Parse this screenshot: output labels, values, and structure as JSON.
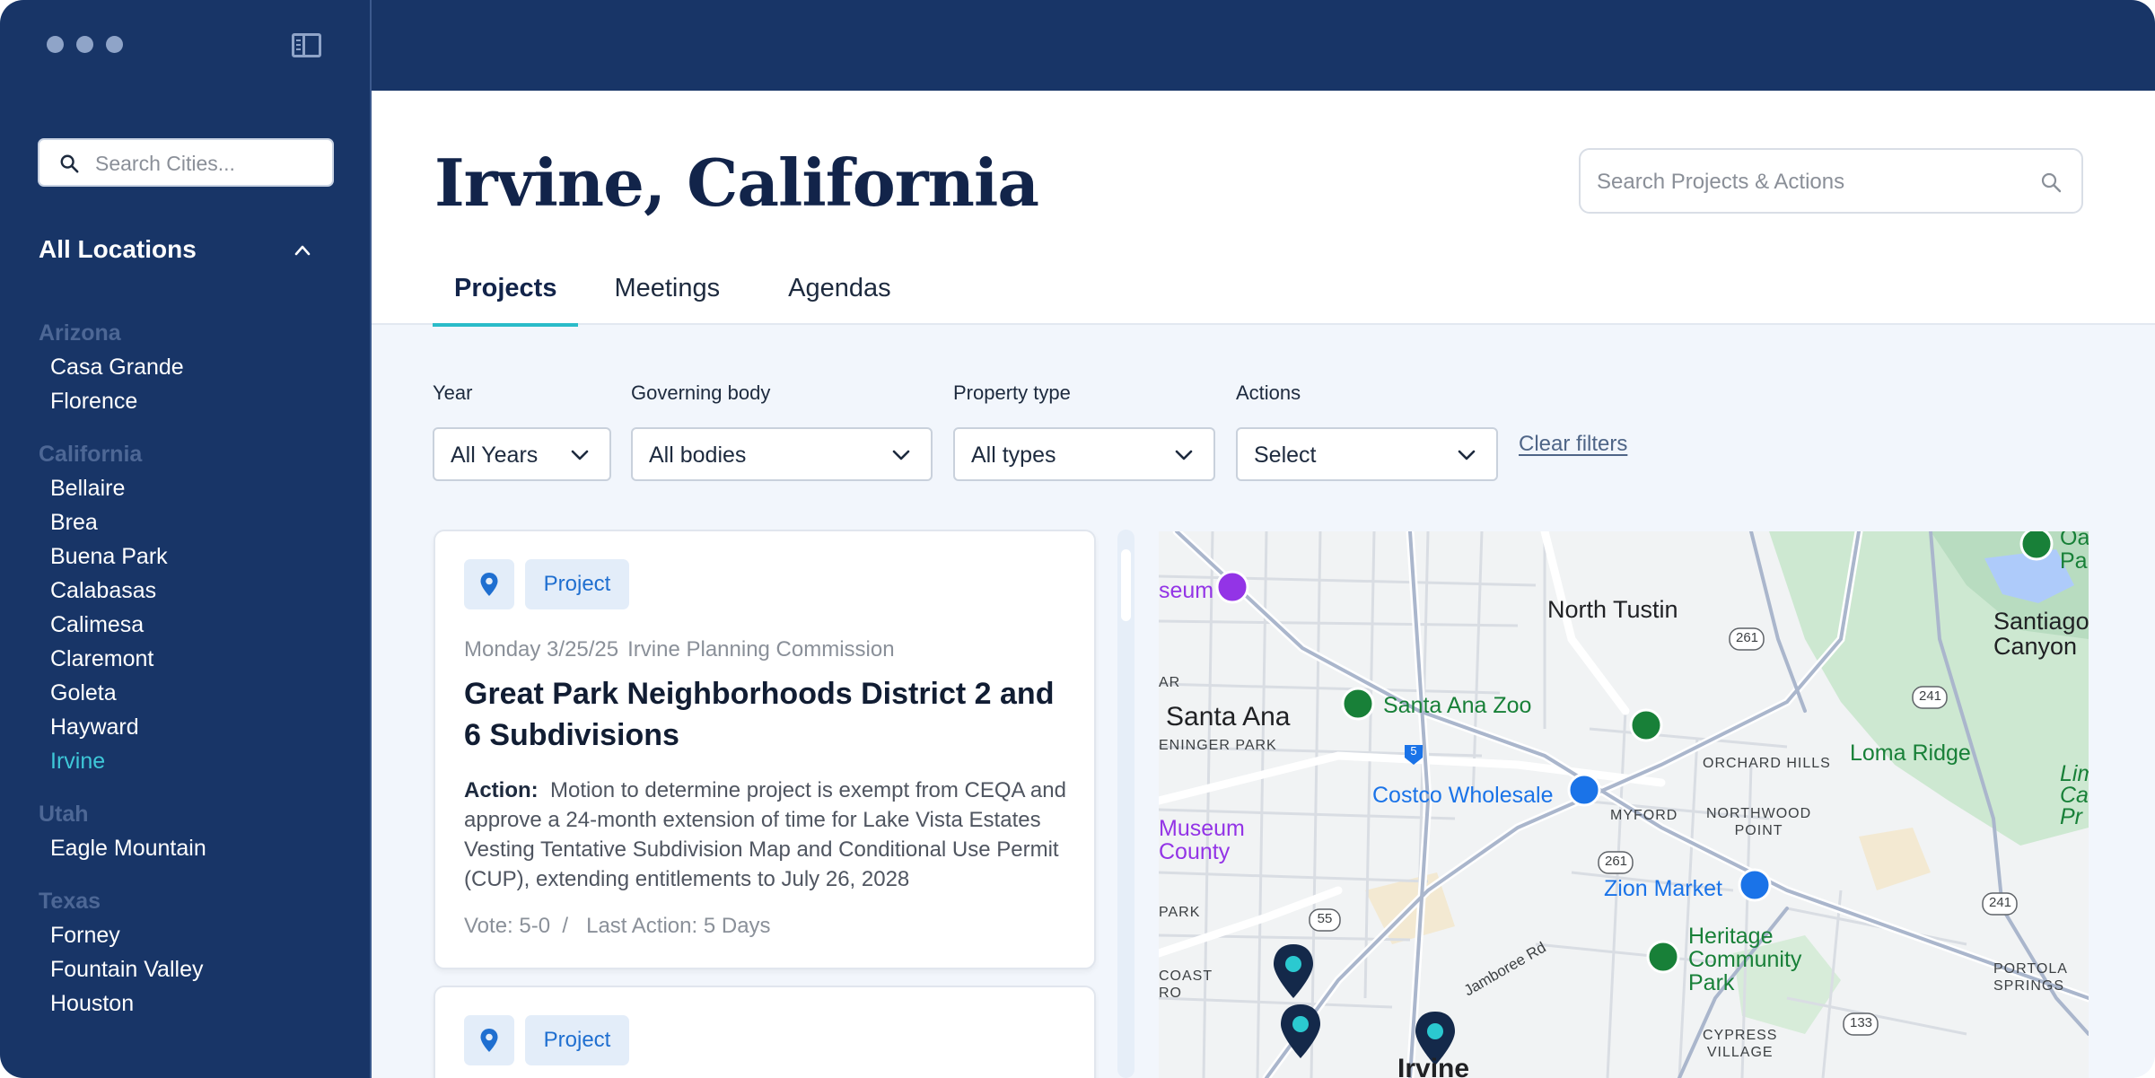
{
  "sidebar": {
    "search_placeholder": "Search Cities...",
    "all_locations_label": "All Locations",
    "groups": [
      {
        "state": "Arizona",
        "cities": [
          "Casa Grande",
          "Florence"
        ]
      },
      {
        "state": "California",
        "cities": [
          "Bellaire",
          "Brea",
          "Buena Park",
          "Calabasas",
          "Calimesa",
          "Claremont",
          "Goleta",
          "Hayward",
          "Irvine"
        ]
      },
      {
        "state": "Utah",
        "cities": [
          "Eagle Mountain"
        ]
      },
      {
        "state": "Texas",
        "cities": [
          "Forney",
          "Fountain Valley",
          "Houston"
        ]
      }
    ],
    "active_city": "Irvine"
  },
  "header": {
    "title": "Irvine, California",
    "search_placeholder": "Search Projects & Actions",
    "tabs": [
      "Projects",
      "Meetings",
      "Agendas"
    ],
    "active_tab": "Projects"
  },
  "filters": {
    "year": {
      "label": "Year",
      "value": "All Years"
    },
    "body": {
      "label": "Governing body",
      "value": "All bodies"
    },
    "property": {
      "label": "Property type",
      "value": "All types"
    },
    "actions": {
      "label": "Actions",
      "value": "Select"
    },
    "clear_label": "Clear filters"
  },
  "cards": [
    {
      "type": "Project",
      "date": "Monday 3/25/25",
      "body": "Irvine Planning Commission",
      "title": "Great Park Neighborhoods District 2 and 6 Subdivisions",
      "action_label": "Action:",
      "action_text": "Motion to determine project is exempt from CEQA and approve a 24-month extension of time for Lake Vista Estates Vesting Tentative Subdivision Map and Conditional Use Permit (CUP), extending entitlements to July 26, 2028",
      "vote": "Vote: 5-0",
      "last_action": "Last Action: 5 Days"
    },
    {
      "type": "Project"
    }
  ],
  "map": {
    "labels": {
      "north_tustin": "North Tustin",
      "santiago_canyon": "Santiago\nCanyon",
      "santa_ana": "Santa Ana",
      "santa_ana_zoo": "Santa Ana Zoo",
      "eninger_park": "ENINGER PARK",
      "orchard_hills": "ORCHARD HILLS",
      "loma_ridge": "Loma Ridge",
      "costco": "Costco Wholesale",
      "myford": "MYFORD",
      "northwood_point": "NORTHWOOD\nPOINT",
      "zion_market": "Zion Market",
      "heritage_park": "Heritage\nCommunity\nPark",
      "portola_springs": "PORTOLA\nSPRINGS",
      "cypress_village": "CYPRESS\nVILLAGE",
      "irvine": "Irvine",
      "jamboree": "Jamboree Rd",
      "museum_top": "seum",
      "museum_county": "Museum\nCounty",
      "park_left": "PARK",
      "coast": "COAST\nRO",
      "ar": "AR",
      "lim": "Lim\nCanyo\nPr",
      "top_right": "Oa\nPa",
      "hwy_261a": "261",
      "hwy_241a": "241",
      "hwy_261b": "261",
      "hwy_241b": "241",
      "hwy_55": "55",
      "hwy_133": "133",
      "hwy_5": "5"
    }
  },
  "colors": {
    "navy": "#183567",
    "accent": "#2bbcc9",
    "badge_blue": "#1f6fd0",
    "map_pin": "#14294a",
    "pin_dot": "#2bc9d0"
  }
}
